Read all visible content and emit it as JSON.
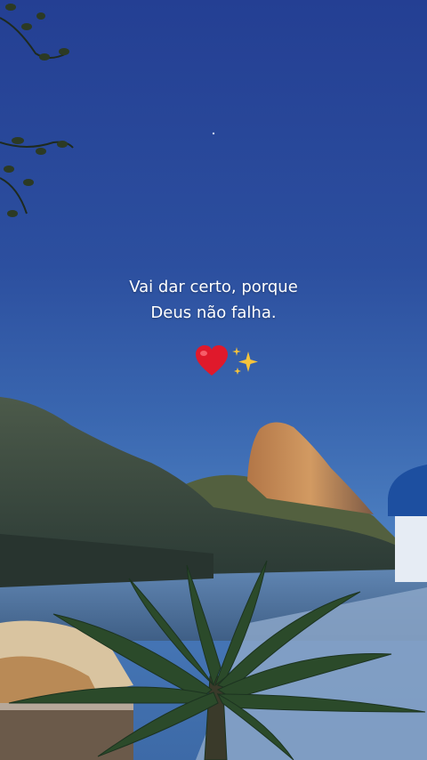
{
  "caption": {
    "line1": "Vai dar certo, porque",
    "line2": "Deus não falha."
  },
  "emojis": [
    "heart-icon",
    "sparkles-icon"
  ],
  "colors": {
    "sky_top": "#243f93",
    "sky_bottom": "#4b7ec0",
    "heart": "#e0192b",
    "sparkle": "#f5c33b",
    "peak_sunlit": "#c98a52",
    "water": "#5f88b8"
  }
}
